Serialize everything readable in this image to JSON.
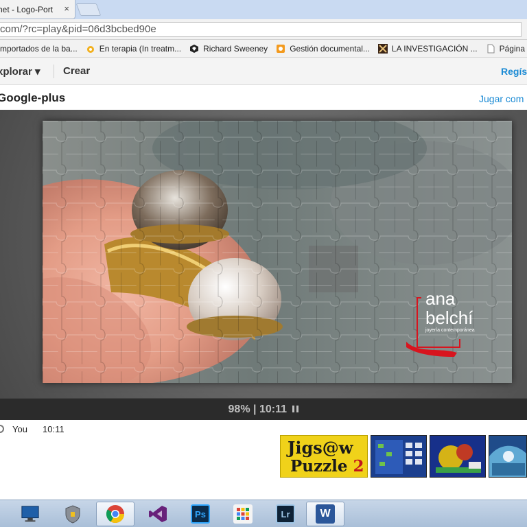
{
  "browser": {
    "tab_title": "net - Logo-Port",
    "tab_close": "×",
    "url": "com/?rc=play&pid=06d3bcbed90e"
  },
  "bookmarks": [
    {
      "label": "mportados de la ba...",
      "icon": "folder-icon"
    },
    {
      "label": "En terapia (In treatm...",
      "icon": "film-icon"
    },
    {
      "label": "Richard Sweeney",
      "icon": "hexagon-icon"
    },
    {
      "label": "Gestión documental...",
      "icon": "document-icon"
    },
    {
      "label": "LA INVESTIGACIÓN ...",
      "icon": "logo-icon"
    },
    {
      "label": "Página pri",
      "icon": "page-icon"
    }
  ],
  "site_nav": {
    "explorar": "xplorar ▾",
    "crear": "Crear",
    "register": "Regís"
  },
  "puzzle": {
    "title": "Google-plus",
    "play_link": "Jugar com",
    "logo_line1": "ana",
    "logo_line2": "belchí",
    "logo_line3": "joyería contemporánea",
    "progress": "98%",
    "separator": "|",
    "timer": "10:11"
  },
  "player": {
    "name": "You",
    "time": "10:11"
  },
  "promo": {
    "line1": "Jigs@w",
    "line2_a": "Puzzle ",
    "line2_b": "2"
  },
  "colors": {
    "link": "#1a8ad4",
    "stage": "#5e5e5e",
    "accent_red": "#d8141e"
  }
}
